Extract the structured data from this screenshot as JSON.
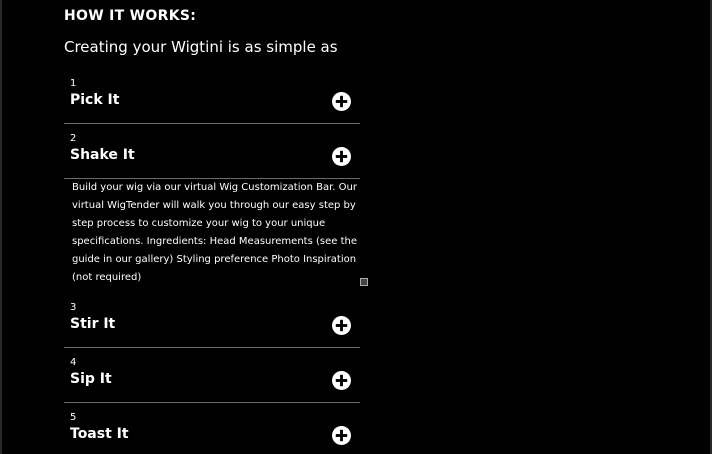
{
  "section": {
    "title": "HOW IT WORKS:",
    "intro": "Creating your Wigtini is as simple as"
  },
  "steps": [
    {
      "number": "1",
      "title": "Pick It",
      "icon": "plus-circle-icon"
    },
    {
      "number": "2",
      "title": "Shake It",
      "icon": "plus-circle-icon",
      "expanded": true,
      "body": "Build your wig via our virtual Wig Customization Bar. Our virtual WigTender will walk you through our easy step by step process to customize your wig to your unique specifications. Ingredients: Head Measurements (see the guide in our gallery) Styling preference Photo Inspiration (not required)"
    },
    {
      "number": "3",
      "title": "Stir It",
      "icon": "plus-circle-icon"
    },
    {
      "number": "4",
      "title": "Sip It",
      "icon": "plus-circle-icon"
    },
    {
      "number": "5",
      "title": "Toast It",
      "icon": "plus-circle-icon"
    }
  ],
  "colors": {
    "background": "#000000",
    "text": "#ffffff",
    "divider": "#6a6a6a"
  }
}
